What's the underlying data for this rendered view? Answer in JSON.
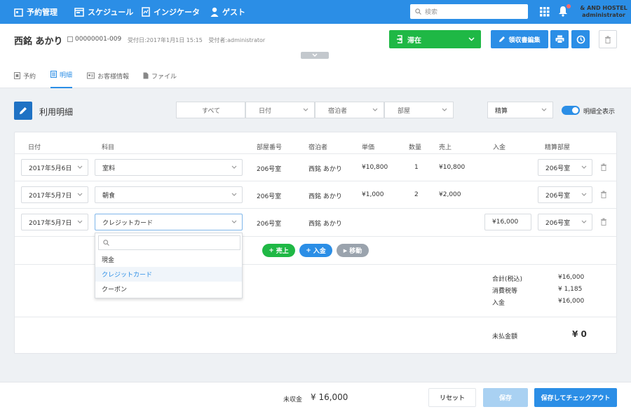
{
  "nav": {
    "items": [
      {
        "label": "予約管理",
        "icon": "calendar-icon"
      },
      {
        "label": "スケジュール",
        "icon": "schedule-icon"
      },
      {
        "label": "インジケータ",
        "icon": "indicator-icon"
      },
      {
        "label": "ゲスト",
        "icon": "guest-icon"
      }
    ],
    "search_placeholder": "検索",
    "user_line1": "& AND HOSTEL",
    "user_line2": "administrator"
  },
  "header": {
    "guest_name": "西銘 あかり",
    "reservation_no": "00000001-009",
    "received_date": "受付日:2017年1月1日 15:15",
    "received_by": "受付者:administrator",
    "status_label": "滞在",
    "receipt_button": "領収書編集"
  },
  "tabs": [
    {
      "label": "予約",
      "active": false
    },
    {
      "label": "明細",
      "active": true
    },
    {
      "label": "お客様情報",
      "active": false
    },
    {
      "label": "ファイル",
      "active": false
    }
  ],
  "section": {
    "title": "利用明細",
    "filters": [
      "すべて",
      "日付",
      "宿泊者",
      "部屋"
    ],
    "settle_select": "精算",
    "toggle_label": "明細全表示"
  },
  "table": {
    "headers": [
      "日付",
      "科目",
      "部屋番号",
      "宿泊者",
      "単価",
      "数量",
      "売上",
      "入金",
      "精算部屋"
    ],
    "rows": [
      {
        "date": "2017年5月6日",
        "item": "室料",
        "room": "206号室",
        "guest": "西銘 あかり",
        "unit_price": "¥10,800",
        "qty": "1",
        "sales": "¥10,800",
        "payment": "",
        "settle_room": "206号室"
      },
      {
        "date": "2017年5月7日",
        "item": "朝食",
        "room": "206号室",
        "guest": "西銘 あかり",
        "unit_price": "¥1,000",
        "qty": "2",
        "sales": "¥2,000",
        "payment": "",
        "settle_room": "206号室"
      },
      {
        "date": "2017年5月7日",
        "item": "クレジットカード",
        "room": "206号室",
        "guest": "西銘 あかり",
        "unit_price": "",
        "qty": "",
        "sales": "",
        "payment": "¥16,000",
        "settle_room": "206号室"
      }
    ],
    "add_buttons": [
      "売上",
      "入金",
      "移動"
    ]
  },
  "dropdown": {
    "options": [
      "現金",
      "クレジットカード",
      "クーポン"
    ],
    "highlighted": "クレジットカード"
  },
  "summary": {
    "items": [
      {
        "label": "合計(税込)",
        "value": "¥16,000"
      },
      {
        "label": "消費税等",
        "value": "¥ 1,185"
      },
      {
        "label": "入金",
        "value": "¥16,000"
      }
    ],
    "balance_label": "未払金額",
    "balance_value": "¥ 0"
  },
  "footer": {
    "uncollected_label": "未収金",
    "uncollected_value": "¥ 16,000",
    "reset": "リセット",
    "save": "保存",
    "save_checkout": "保存してチェックアウト"
  },
  "colors": {
    "primary": "#2b8ee6",
    "green": "#1fb845",
    "grey_button": "#9aa3ad"
  }
}
